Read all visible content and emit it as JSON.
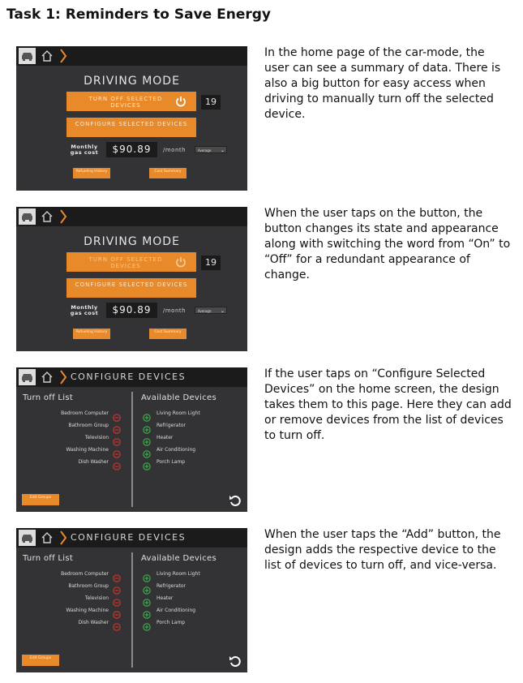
{
  "task_title": "Task 1: Reminders to Save Energy",
  "screens": {
    "drive1": {
      "title": "DRIVING MODE",
      "turn_off_label": "TURN OFF SELECTED DEVICES",
      "configure_label": "CONFIGURE SELECTED DEVICES",
      "device_count": "19",
      "gas_label": "Monthly gas cost",
      "gas_value": "$90.89",
      "per_month": "/month",
      "period_select": "Average",
      "refueling_label": "Refueling History",
      "cost_label": "Cost Summary"
    },
    "drive2": {
      "title": "DRIVING MODE",
      "turn_off_label": "TURN OFF SELECTED DEVICES",
      "configure_label": "CONFIGURE SELECTED DEVICES",
      "device_count": "19",
      "gas_label": "Monthly gas cost",
      "gas_value": "$90.89",
      "per_month": "/month",
      "period_select": "Average",
      "refueling_label": "Refueling History",
      "cost_label": "Cost Summary"
    },
    "config1": {
      "bar_title": "CONFIGURE DEVICES",
      "turn_off_heading": "Turn off List",
      "available_heading": "Available Devices",
      "turn_off_list": [
        "Bedroom Computer",
        "Bathroom Group",
        "Television",
        "Washing Machine",
        "Dish Washer"
      ],
      "available_list": [
        "Living Room Light",
        "Refrigerator",
        "Heater",
        "Air Conditioning",
        "Porch Lamp"
      ],
      "edit_label": "Edit Groups"
    },
    "config2": {
      "bar_title": "CONFIGURE DEVICES",
      "turn_off_heading": "Turn off List",
      "available_heading": "Available Devices",
      "turn_off_list": [
        "Bedroom Computer",
        "Bathroom Group",
        "Television",
        "Washing Machine",
        "Dish Washer"
      ],
      "available_list": [
        "Living Room Light",
        "Refrigerator",
        "Heater",
        "Air Conditioning",
        "Porch Lamp"
      ],
      "edit_label": "Edit Groups"
    }
  },
  "descriptions": [
    "In the home page of the car-mode, the user can see a summary of data. There is also a big button for easy access when driving to manually turn off the selected device.",
    "When the user taps on the button, the button changes its state and appearance along with switching the word from “On” to “Off” for a redundant appearance of change.",
    "If the user taps on “Configure Selected Devices” on the home screen, the design takes them to this page. Here they can add or remove devices from the list of devices to turn off.",
    "When the user taps the “Add” button, the design adds the respective device to the list of devices to turn off, and vice-versa."
  ],
  "icons": {
    "top_left": "car-icon",
    "nav": "home-icon",
    "breadcrumb": "chevron-right-icon",
    "power": "power-icon",
    "remove": "minus-circle-icon",
    "add": "plus-circle-icon",
    "undo": "undo-icon"
  },
  "colors": {
    "accent": "#e8892a",
    "screen_bg": "#333335",
    "bar_bg": "#1b1b1b",
    "remove": "#d9342b",
    "add": "#3bb54a"
  }
}
